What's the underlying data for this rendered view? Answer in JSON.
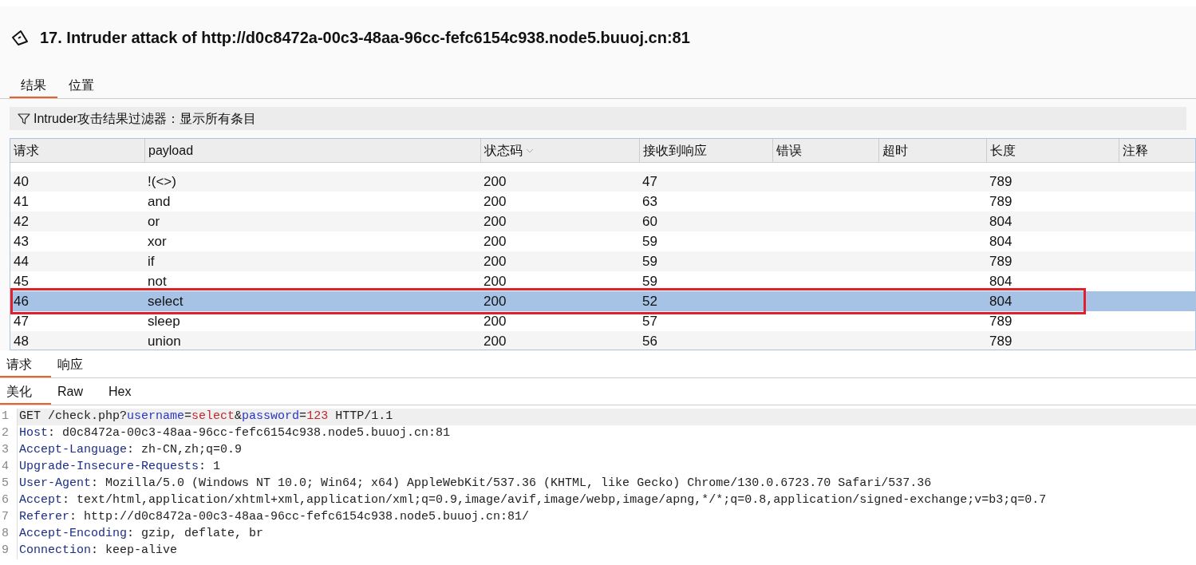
{
  "title": "17. Intruder attack of http://d0c8472a-00c3-48aa-96cc-fefc6154c938.node5.buuoj.cn:81",
  "tabs": [
    {
      "label": "结果",
      "selected": true
    },
    {
      "label": "位置",
      "selected": false
    }
  ],
  "filter": {
    "label": "Intruder攻击结果过滤器：显示所有条目"
  },
  "table": {
    "columns": [
      {
        "label": "请求",
        "sorted": false
      },
      {
        "label": "payload",
        "sorted": false
      },
      {
        "label": "状态码",
        "sorted": true
      },
      {
        "label": "接收到响应",
        "sorted": false
      },
      {
        "label": "错误",
        "sorted": false
      },
      {
        "label": "超时",
        "sorted": false
      },
      {
        "label": "长度",
        "sorted": false
      },
      {
        "label": "注释",
        "sorted": false
      }
    ],
    "rows": [
      {
        "cells": [
          "40",
          "!(<>)",
          "200",
          "47",
          "",
          "",
          "789",
          ""
        ],
        "selected": false,
        "marked": false
      },
      {
        "cells": [
          "41",
          "and",
          "200",
          "63",
          "",
          "",
          "789",
          ""
        ],
        "selected": false,
        "marked": false
      },
      {
        "cells": [
          "42",
          "or",
          "200",
          "60",
          "",
          "",
          "804",
          ""
        ],
        "selected": false,
        "marked": false
      },
      {
        "cells": [
          "43",
          "xor",
          "200",
          "59",
          "",
          "",
          "804",
          ""
        ],
        "selected": false,
        "marked": false
      },
      {
        "cells": [
          "44",
          "if",
          "200",
          "59",
          "",
          "",
          "789",
          ""
        ],
        "selected": false,
        "marked": false
      },
      {
        "cells": [
          "45",
          "not",
          "200",
          "59",
          "",
          "",
          "804",
          ""
        ],
        "selected": false,
        "marked": false
      },
      {
        "cells": [
          "46",
          "select",
          "200",
          "52",
          "",
          "",
          "804",
          ""
        ],
        "selected": true,
        "marked": true
      },
      {
        "cells": [
          "47",
          "sleep",
          "200",
          "57",
          "",
          "",
          "789",
          ""
        ],
        "selected": false,
        "marked": false
      },
      {
        "cells": [
          "48",
          "union",
          "200",
          "56",
          "",
          "",
          "789",
          ""
        ],
        "selected": false,
        "marked": false
      }
    ]
  },
  "message_tabs": [
    {
      "label": "请求",
      "selected": true
    },
    {
      "label": "响应",
      "selected": false
    }
  ],
  "view_tabs": [
    {
      "label": "美化",
      "selected": true
    },
    {
      "label": "Raw",
      "selected": false
    },
    {
      "label": "Hex",
      "selected": false
    }
  ],
  "editor": {
    "lines": [
      {
        "number": "1",
        "highlighted": true,
        "segments": [
          {
            "kind": "plain",
            "text": "GET /check.php?"
          },
          {
            "kind": "param",
            "text": "username"
          },
          {
            "kind": "plain",
            "text": "="
          },
          {
            "kind": "value",
            "text": "select"
          },
          {
            "kind": "plain",
            "text": "&"
          },
          {
            "kind": "param",
            "text": "password"
          },
          {
            "kind": "plain",
            "text": "="
          },
          {
            "kind": "value",
            "text": "123"
          },
          {
            "kind": "plain",
            "text": " HTTP/1.1"
          }
        ]
      },
      {
        "number": "2",
        "highlighted": false,
        "segments": [
          {
            "kind": "header",
            "text": "Host"
          },
          {
            "kind": "plain",
            "text": ": d0c8472a-00c3-48aa-96cc-fefc6154c938.node5.buuoj.cn:81"
          }
        ]
      },
      {
        "number": "3",
        "highlighted": false,
        "segments": [
          {
            "kind": "header",
            "text": "Accept-Language"
          },
          {
            "kind": "plain",
            "text": ": zh-CN,zh;q=0.9"
          }
        ]
      },
      {
        "number": "4",
        "highlighted": false,
        "segments": [
          {
            "kind": "header",
            "text": "Upgrade-Insecure-Requests"
          },
          {
            "kind": "plain",
            "text": ": 1"
          }
        ]
      },
      {
        "number": "5",
        "highlighted": false,
        "segments": [
          {
            "kind": "header",
            "text": "User-Agent"
          },
          {
            "kind": "plain",
            "text": ": Mozilla/5.0 (Windows NT 10.0; Win64; x64) AppleWebKit/537.36 (KHTML, like Gecko) Chrome/130.0.6723.70 Safari/537.36"
          }
        ]
      },
      {
        "number": "6",
        "highlighted": false,
        "segments": [
          {
            "kind": "header",
            "text": "Accept"
          },
          {
            "kind": "plain",
            "text": ": text/html,application/xhtml+xml,application/xml;q=0.9,image/avif,image/webp,image/apng,*/*;q=0.8,application/signed-exchange;v=b3;q=0.7"
          }
        ]
      },
      {
        "number": "7",
        "highlighted": false,
        "segments": [
          {
            "kind": "header",
            "text": "Referer"
          },
          {
            "kind": "plain",
            "text": ": http://d0c8472a-00c3-48aa-96cc-fefc6154c938.node5.buuoj.cn:81/"
          }
        ]
      },
      {
        "number": "8",
        "highlighted": false,
        "segments": [
          {
            "kind": "header",
            "text": "Accept-Encoding"
          },
          {
            "kind": "plain",
            "text": ": gzip, deflate, br"
          }
        ]
      },
      {
        "number": "9",
        "highlighted": false,
        "segments": [
          {
            "kind": "header",
            "text": "Connection"
          },
          {
            "kind": "plain",
            "text": ": keep-alive"
          }
        ]
      }
    ]
  }
}
